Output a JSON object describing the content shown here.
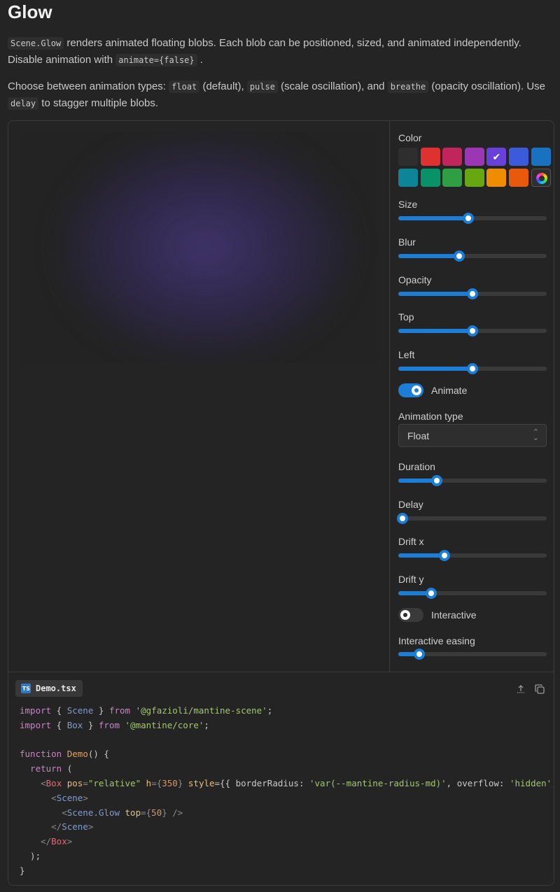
{
  "page": {
    "title": "Glow",
    "p1": {
      "code1": "Scene.Glow",
      "text1": " renders animated floating blobs. Each blob can be positioned, sized, and animated independently. Disable animation with ",
      "code2": "animate={false}",
      "text2": " ."
    },
    "p2": {
      "text0": "Choose between animation types: ",
      "code1": "float",
      "text1": " (default), ",
      "code2": "pulse",
      "text2": " (scale oscillation), and ",
      "code3": "breathe",
      "text3": " (opacity oscillation). Use ",
      "code4": "delay",
      "text4": " to stagger multiple blobs."
    }
  },
  "controls": {
    "color": {
      "label": "Color",
      "swatches": [
        "#2e2e2e",
        "#e03131",
        "#c2255c",
        "#9c36b5",
        "#6741d9",
        "#3b5bdb",
        "#1971c2",
        "#0c8599",
        "#099268",
        "#2f9e44",
        "#66a80f",
        "#f08c00",
        "#e8590c"
      ],
      "selected_index": 4,
      "picker_icon": "color-wheel-icon"
    },
    "size": {
      "label": "Size",
      "value": 0.47
    },
    "blur": {
      "label": "Blur",
      "value": 0.41
    },
    "opacity": {
      "label": "Opacity",
      "value": 0.5
    },
    "top": {
      "label": "Top",
      "value": 0.5
    },
    "left": {
      "label": "Left",
      "value": 0.5
    },
    "animate": {
      "label": "Animate",
      "on": true
    },
    "animation_type": {
      "label": "Animation type",
      "value": "Float"
    },
    "duration": {
      "label": "Duration",
      "value": 0.26
    },
    "delay": {
      "label": "Delay",
      "value": 0.03
    },
    "drift_x": {
      "label": "Drift x",
      "value": 0.31
    },
    "drift_y": {
      "label": "Drift y",
      "value": 0.22
    },
    "interactive": {
      "label": "Interactive",
      "on": false
    },
    "interactive_easing": {
      "label": "Interactive easing",
      "value": 0.14
    }
  },
  "code": {
    "file_name": "Demo.tsx",
    "ts_badge": "TS",
    "l1a": "import",
    "l1b": " { ",
    "l1c": "Scene",
    "l1d": " } ",
    "l1e": "from",
    "l1f": " '@gfazioli/mantine-scene'",
    "l1g": ";",
    "l2a": "import",
    "l2b": " { ",
    "l2c": "Box",
    "l2d": " } ",
    "l2e": "from",
    "l2f": " '@mantine/core'",
    "l2g": ";",
    "l4a": "function",
    "l4b": " Demo",
    "l4c": "() {",
    "l5a": "  return",
    "l5b": " (",
    "l6a": "    <",
    "l6b": "Box",
    "l6c": " pos",
    "l6d": "=",
    "l6e": "\"relative\"",
    "l6f": " h",
    "l6g": "={",
    "l6h": "350",
    "l6i": "} ",
    "l6j": "style",
    "l6k": "={{ borderRadius: ",
    "l6l": "'var(--mantine-radius-md)'",
    "l6m": ", overflow: ",
    "l6n": "'hidden'",
    "l6o": ", b",
    "l7a": "      <",
    "l7b": "Scene",
    "l7c": ">",
    "l8a": "        <",
    "l8b": "Scene.Glow",
    "l8c": " top",
    "l8d": "={",
    "l8e": "50",
    "l8f": "} />",
    "l9a": "      </",
    "l9b": "Scene",
    "l9c": ">",
    "l10a": "    </",
    "l10b": "Box",
    "l10c": ">",
    "l11": "  );",
    "l12": "}"
  }
}
